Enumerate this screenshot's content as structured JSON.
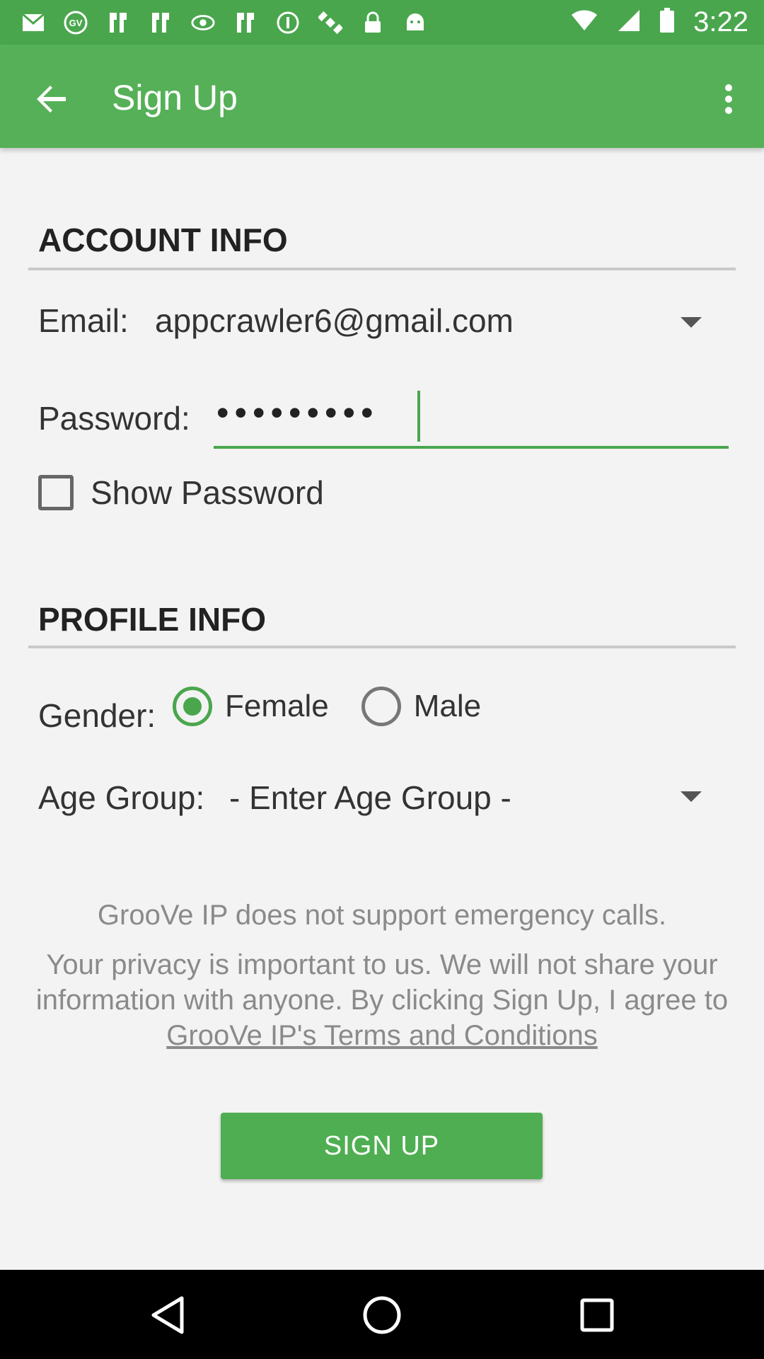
{
  "status_bar": {
    "time": "3:22",
    "icons": [
      "mail-icon",
      "gv-icon",
      "notification-icon",
      "notification-icon",
      "eye-icon",
      "notification-icon",
      "pocket-icon",
      "satellite-icon",
      "lock-icon",
      "android-icon"
    ]
  },
  "app_bar": {
    "title": "Sign Up"
  },
  "account_info": {
    "header": "ACCOUNT INFO",
    "email_label": "Email:",
    "email_value": "appcrawler6@gmail.com",
    "password_label": "Password:",
    "password_value": "•••••••••",
    "show_password_label": "Show Password",
    "show_password_checked": false
  },
  "profile_info": {
    "header": "PROFILE INFO",
    "gender_label": "Gender:",
    "gender_options": [
      "Female",
      "Male"
    ],
    "gender_selected": "Female",
    "age_group_label": "Age Group:",
    "age_group_value": "- Enter Age Group -"
  },
  "notices": {
    "emergency": "GrooVe IP does not support emergency calls.",
    "privacy_line1": "Your privacy is important to us. We will not share your",
    "privacy_line2": "information with anyone. By clicking Sign Up, I agree to",
    "terms_link": "GrooVe IP's Terms and Conditions"
  },
  "signup_button": "SIGN UP",
  "colors": {
    "primary": "#55b058",
    "status_bar": "#4aa64d",
    "background": "#f3f3f3"
  }
}
